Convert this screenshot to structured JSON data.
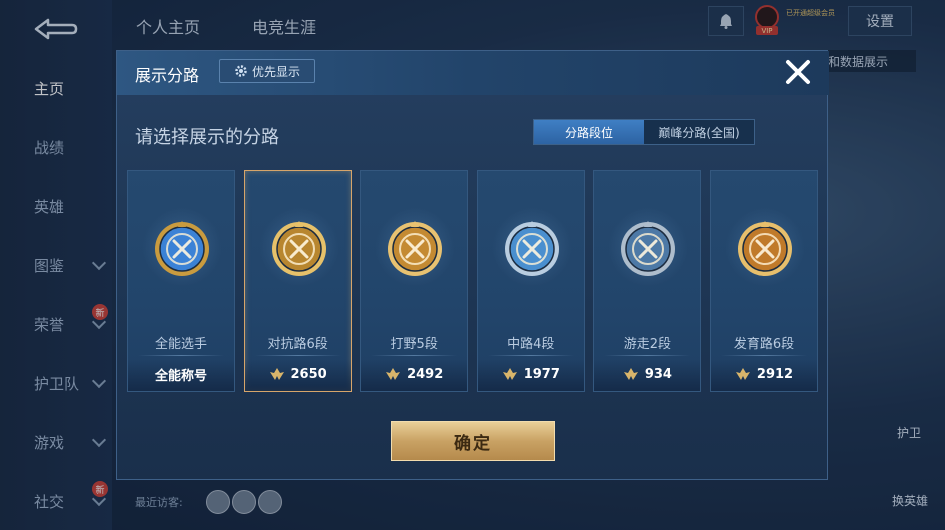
{
  "sidebar": {
    "items": [
      {
        "label": "主页",
        "active": true,
        "chevron": false,
        "badge": ""
      },
      {
        "label": "战绩",
        "active": false,
        "chevron": false,
        "badge": ""
      },
      {
        "label": "英雄",
        "active": false,
        "chevron": false,
        "badge": ""
      },
      {
        "label": "图鉴",
        "active": false,
        "chevron": true,
        "badge": ""
      },
      {
        "label": "荣誉",
        "active": false,
        "chevron": true,
        "badge": "新"
      },
      {
        "label": "护卫队",
        "active": false,
        "chevron": true,
        "badge": ""
      },
      {
        "label": "游戏",
        "active": false,
        "chevron": true,
        "badge": ""
      },
      {
        "label": "社交",
        "active": false,
        "chevron": true,
        "badge": "新"
      }
    ]
  },
  "topnav": {
    "tab1": "个人主页",
    "tab2": "电竞生涯"
  },
  "topbar": {
    "settings_label": "设置",
    "promo_text": "已开通超级会员",
    "vip_label": "VIP"
  },
  "background_text": {
    "behind_modal": "主和数据展示",
    "recent_visitors": "最近访客:",
    "swap_hero": "换英雄",
    "guard": "护卫"
  },
  "modal": {
    "title": "展示分路",
    "priority_label": "优先显示",
    "subtitle": "请选择展示的分路",
    "tabs": [
      {
        "label": "分路段位",
        "active": true
      },
      {
        "label": "巅峰分路(全国)",
        "active": false
      }
    ],
    "cards": [
      {
        "name": "全能选手",
        "value": "全能称号",
        "has_icon": false,
        "selected": false,
        "badge_color": "#3b82d6",
        "badge_rim": "#c99b3f"
      },
      {
        "name": "对抗路6段",
        "value": "2650",
        "has_icon": true,
        "selected": true,
        "badge_color": "#b8862f",
        "badge_rim": "#e6c16a"
      },
      {
        "name": "打野5段",
        "value": "2492",
        "has_icon": true,
        "selected": false,
        "badge_color": "#c48a32",
        "badge_rim": "#e8c271"
      },
      {
        "name": "中路4段",
        "value": "1977",
        "has_icon": true,
        "selected": false,
        "badge_color": "#4a8fcf",
        "badge_rim": "#b9cde0"
      },
      {
        "name": "游走2段",
        "value": "934",
        "has_icon": true,
        "selected": false,
        "badge_color": "#4d79a6",
        "badge_rim": "#aebdcc"
      },
      {
        "name": "发育路6段",
        "value": "2912",
        "has_icon": true,
        "selected": false,
        "badge_color": "#c07a2a",
        "badge_rim": "#e7bf6c"
      }
    ],
    "confirm_label": "确定"
  },
  "colors": {
    "accent_gold": "#d7a56a",
    "tab_active": "#3f7fc4",
    "score_icon": "#d9b56b"
  }
}
